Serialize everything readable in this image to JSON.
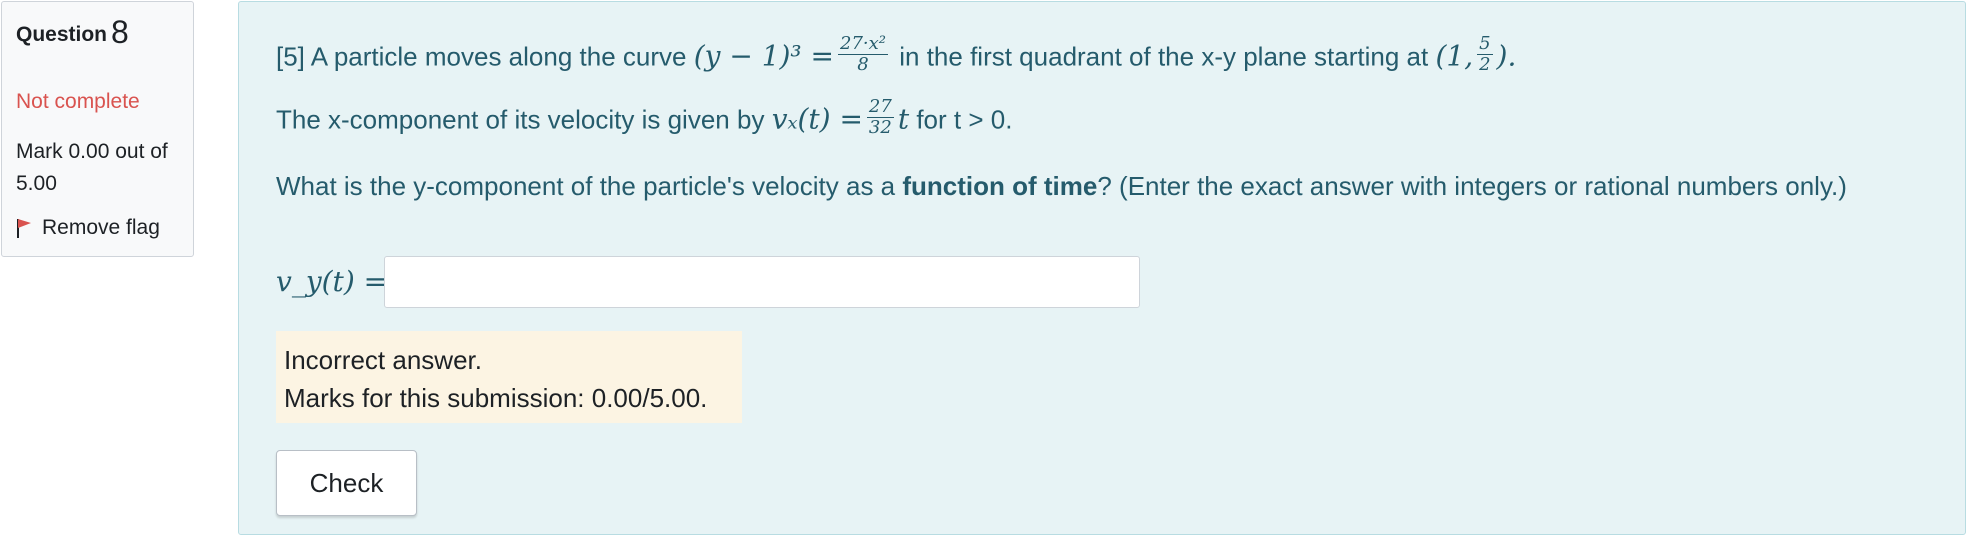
{
  "info": {
    "question_label": "Question",
    "question_number": "8",
    "state": "Not complete",
    "grade_text": "Mark 0.00 out of 5.00",
    "flag_label": "Remove flag"
  },
  "question": {
    "line1_prefix": "[5] A particle moves along the curve",
    "eq1_lhs": "(y − 1)³ =",
    "eq1_num": "27·x²",
    "eq1_den": "8",
    "line1_mid": "in the first quadrant of the x-y plane starting at",
    "point_open": "(1,",
    "point_num": "5",
    "point_den": "2",
    "point_close": ").",
    "line2_prefix": "The x-component of its velocity is given by",
    "vx_lhs": "vₓ(t) =",
    "vx_num": "27",
    "vx_den": "32",
    "vx_t": "t",
    "line2_suffix": "for t > 0.",
    "line3_prefix": "What is the y-component of the particle's velocity as a",
    "line3_bold": "function of time",
    "line3_suffix": "?  (Enter the exact answer with integers or rational numbers only.)"
  },
  "answer": {
    "label": "v_y(t) =",
    "value": ""
  },
  "feedback": {
    "line1": "Incorrect answer.",
    "line2": "Marks for this submission: 0.00/5.00."
  },
  "buttons": {
    "check": "Check"
  },
  "colors": {
    "question_text": "#255b6c",
    "not_complete": "#d9534f",
    "feedback_bg": "#fcf4e3",
    "content_bg": "#e7f3f5"
  }
}
